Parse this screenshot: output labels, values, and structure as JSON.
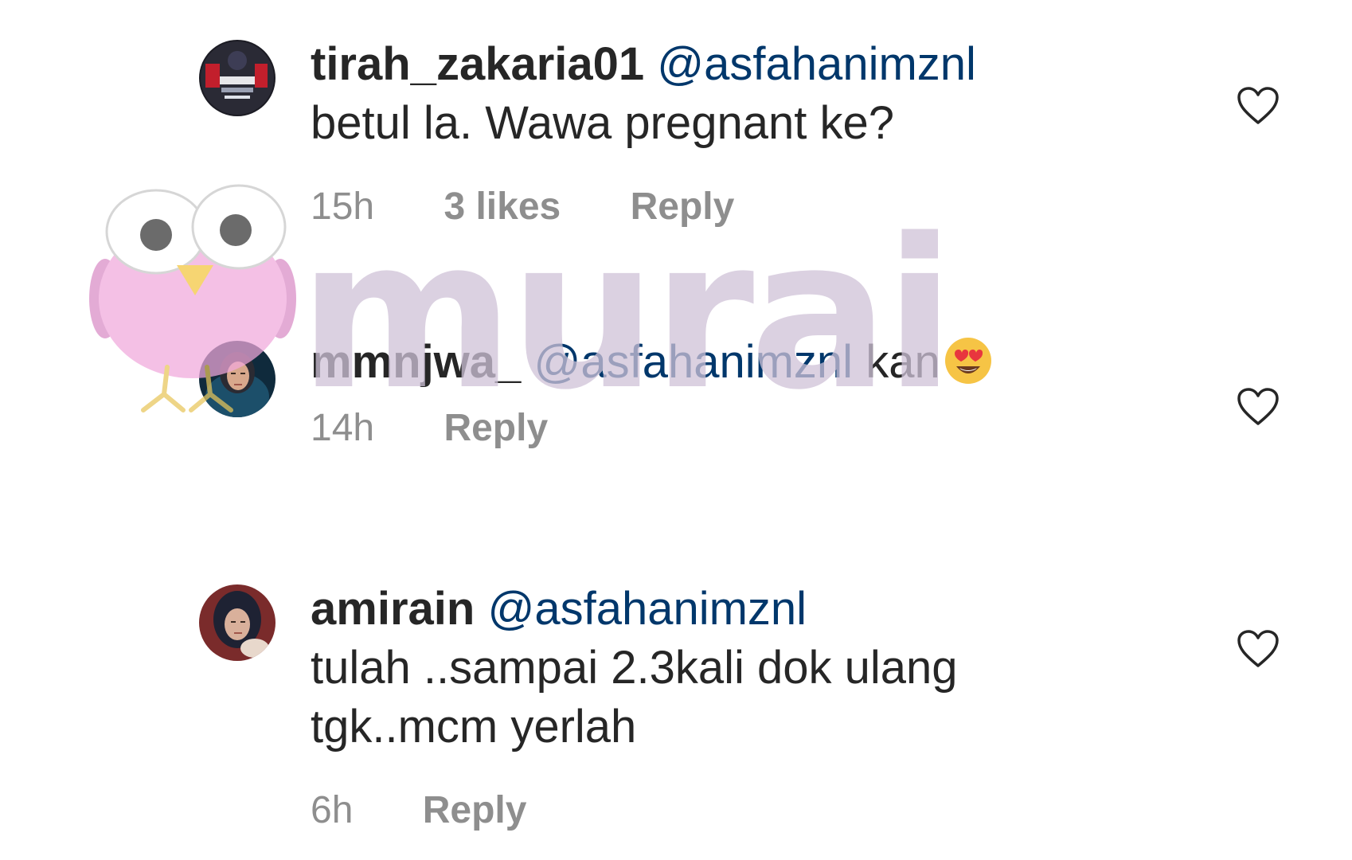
{
  "comments": [
    {
      "username": "tirah_zakaria01",
      "mention": "@asfahanimznl",
      "text": "betul la. Wawa pregnant ke?",
      "time": "15h",
      "likes": "3 likes",
      "reply_label": "Reply"
    },
    {
      "username": "mmnjwa_",
      "mention": "@asfahanimznl",
      "text": "kan",
      "emoji": "heart-eyes-emoji",
      "time": "14h",
      "reply_label": "Reply"
    },
    {
      "username": "amirain",
      "mention": "@asfahanimznl",
      "text_line1": "tulah ..sampai 2.3kali dok ulang",
      "text_line2": "tgk..mcm yerlah",
      "time": "6h",
      "reply_label": "Reply"
    }
  ],
  "watermark": {
    "text": "murai",
    "mascot": "owl-mascot-icon"
  },
  "colors": {
    "username": "#262626",
    "mention": "#00376b",
    "meta": "#8e8e8e",
    "watermark": "#cfc2d8",
    "owl_body": "#f1a8dc"
  }
}
